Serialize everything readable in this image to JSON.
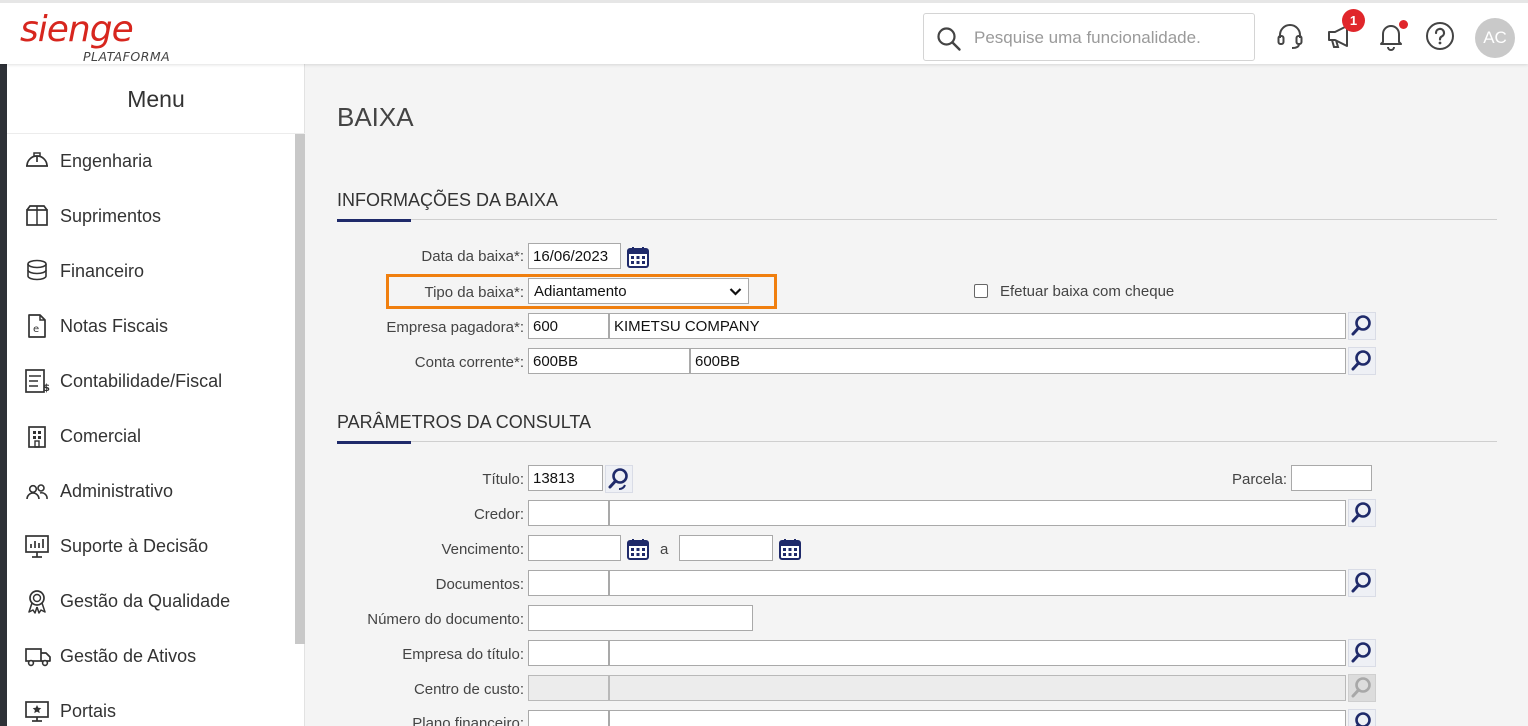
{
  "header": {
    "logo_text": "sienge",
    "logo_subtitle": "PLATAFORMA",
    "search_placeholder": "Pesquise uma funcionalidade.",
    "announcements_badge": "1",
    "avatar_initials": "AC"
  },
  "sidebar": {
    "title": "Menu",
    "items": [
      {
        "label": "Engenharia",
        "icon": "helmet-icon"
      },
      {
        "label": "Suprimentos",
        "icon": "box-icon"
      },
      {
        "label": "Financeiro",
        "icon": "coins-icon"
      },
      {
        "label": "Notas Fiscais",
        "icon": "invoice-icon"
      },
      {
        "label": "Contabilidade/Fiscal",
        "icon": "ledger-icon"
      },
      {
        "label": "Comercial",
        "icon": "building-icon"
      },
      {
        "label": "Administrativo",
        "icon": "users-icon"
      },
      {
        "label": "Suporte à Decisão",
        "icon": "chart-board-icon"
      },
      {
        "label": "Gestão da Qualidade",
        "icon": "award-icon"
      },
      {
        "label": "Gestão de Ativos",
        "icon": "truck-icon"
      },
      {
        "label": "Portais",
        "icon": "portal-icon"
      }
    ]
  },
  "page": {
    "title": "BAIXA"
  },
  "info_section": {
    "title": "INFORMAÇÕES DA BAIXA",
    "data_label": "Data da baixa*:",
    "data_value": "16/06/2023",
    "tipo_label": "Tipo da baixa*:",
    "tipo_value": "Adiantamento",
    "cheque_label": "Efetuar baixa com cheque",
    "empresa_label": "Empresa pagadora*:",
    "empresa_code": "600",
    "empresa_name": "KIMETSU COMPANY",
    "conta_label": "Conta corrente*:",
    "conta_code": "600BB",
    "conta_name": "600BB"
  },
  "params_section": {
    "title": "PARÂMETROS DA CONSULTA",
    "titulo_label": "Título:",
    "titulo_value": "13813",
    "parcela_label": "Parcela:",
    "credor_label": "Credor:",
    "vencimento_label": "Vencimento:",
    "vencimento_sep": "a",
    "documentos_label": "Documentos:",
    "numero_doc_label": "Número do documento:",
    "empresa_titulo_label": "Empresa do título:",
    "centro_custo_label": "Centro de custo:",
    "plano_label": "Plano financeiro:"
  },
  "colors": {
    "brand_red": "#d7261e",
    "accent_navy": "#1f2a6a",
    "highlight_orange": "#f07f0f"
  }
}
